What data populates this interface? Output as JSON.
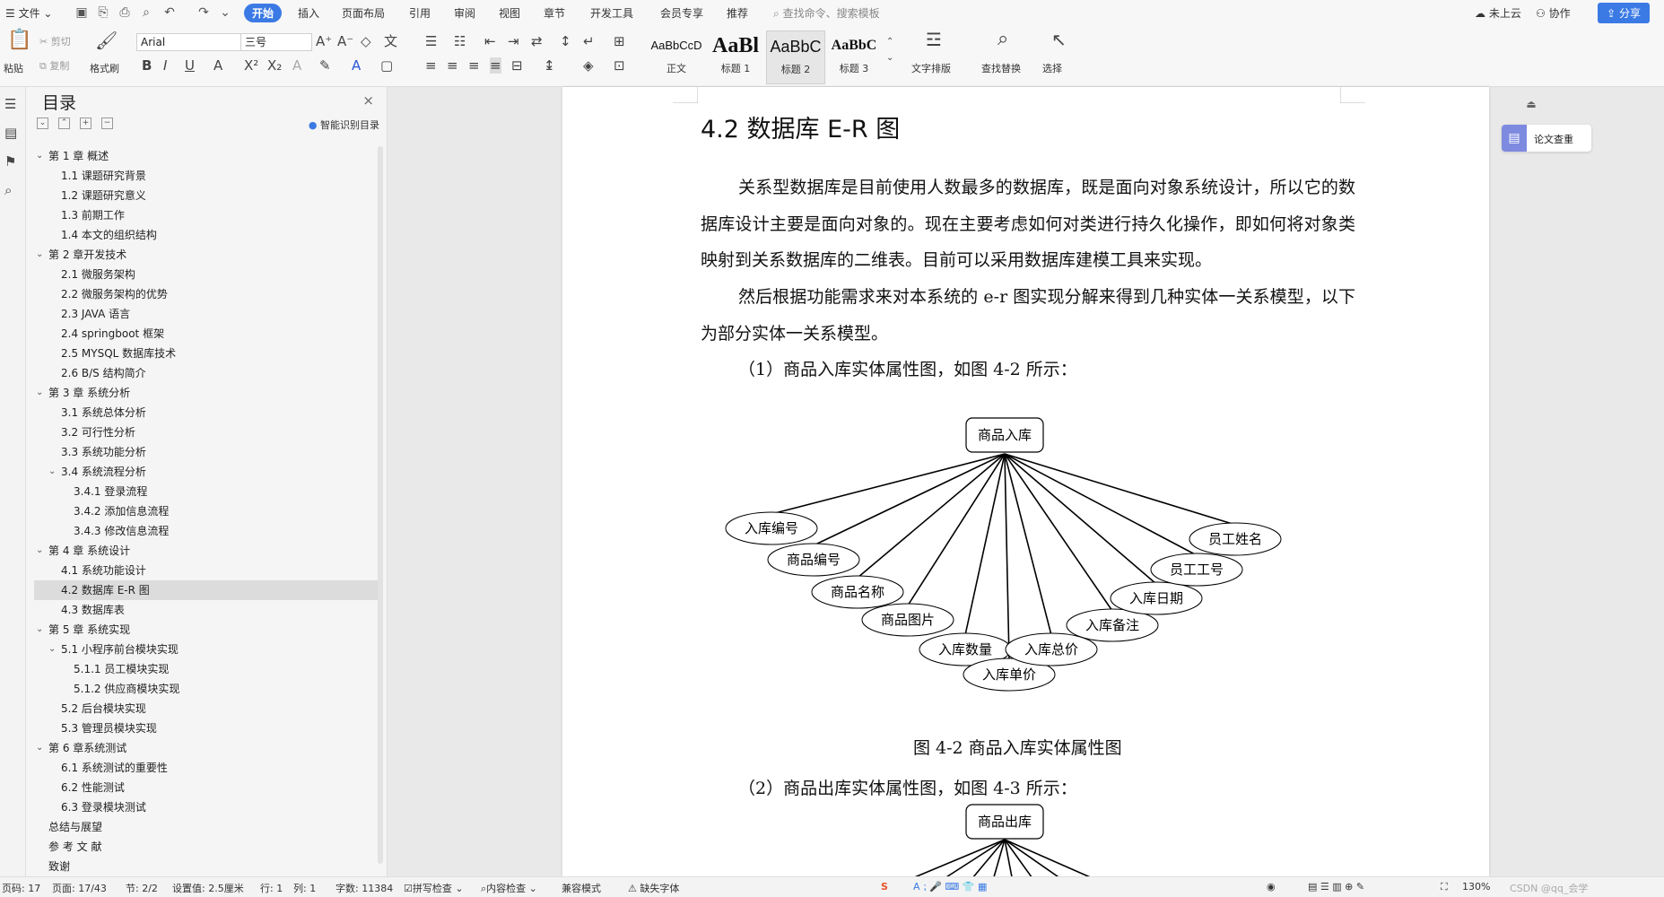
{
  "menubar": {
    "file_menu": "文件",
    "tabs": [
      "开始",
      "插入",
      "页面布局",
      "引用",
      "审阅",
      "视图",
      "章节",
      "开发工具",
      "会员专享",
      "推荐"
    ],
    "active_tab": "开始",
    "search_placeholder": "查找命令、搜索模板",
    "cloud_status": "未上云",
    "collab": "协作",
    "share": "分享"
  },
  "ribbon": {
    "paste": "粘贴",
    "cut": "剪切",
    "copy": "复制",
    "format_painter": "格式刷",
    "font_name": "Arial",
    "font_size": "三号",
    "styles": [
      {
        "preview": "AaBbCcD",
        "label": "正文"
      },
      {
        "preview": "AaBl",
        "label": "标题 1"
      },
      {
        "preview": "AaBbC",
        "label": "标题 2"
      },
      {
        "preview": "AaBbC",
        "label": "标题 3"
      }
    ],
    "text_layout": "文字排版",
    "find_replace": "查找替换",
    "select": "选择"
  },
  "toc": {
    "title": "目录",
    "smart_label": "智能识别目录",
    "items": [
      {
        "label": "第 1 章  概述",
        "level": 1,
        "expand": true,
        "selected": false
      },
      {
        "label": "1.1 课题研究背景",
        "level": 2,
        "expand": false,
        "selected": false
      },
      {
        "label": "1.2 课题研究意义",
        "level": 2,
        "expand": false,
        "selected": false
      },
      {
        "label": "1.3 前期工作",
        "level": 2,
        "expand": false,
        "selected": false
      },
      {
        "label": "1.4 本文的组织结构",
        "level": 2,
        "expand": false,
        "selected": false
      },
      {
        "label": "第 2 章开发技术",
        "level": 1,
        "expand": true,
        "selected": false
      },
      {
        "label": "2.1 微服务架构",
        "level": 2,
        "expand": false,
        "selected": false
      },
      {
        "label": "2.2 微服务架构的优势",
        "level": 2,
        "expand": false,
        "selected": false
      },
      {
        "label": "2.3 JAVA 语言",
        "level": 2,
        "expand": false,
        "selected": false
      },
      {
        "label": "2.4 springboot 框架",
        "level": 2,
        "expand": false,
        "selected": false
      },
      {
        "label": "2.5 MYSQL 数据库技术",
        "level": 2,
        "expand": false,
        "selected": false
      },
      {
        "label": "2.6 B/S 结构简介",
        "level": 2,
        "expand": false,
        "selected": false
      },
      {
        "label": "第 3 章  系统分析",
        "level": 1,
        "expand": true,
        "selected": false
      },
      {
        "label": "3.1 系统总体分析",
        "level": 2,
        "expand": false,
        "selected": false
      },
      {
        "label": "3.2 可行性分析",
        "level": 2,
        "expand": false,
        "selected": false
      },
      {
        "label": "3.3 系统功能分析",
        "level": 2,
        "expand": false,
        "selected": false
      },
      {
        "label": "3.4 系统流程分析",
        "level": 2,
        "expand": true,
        "selected": false
      },
      {
        "label": "3.4.1 登录流程",
        "level": 3,
        "expand": false,
        "selected": false
      },
      {
        "label": "3.4.2 添加信息流程",
        "level": 3,
        "expand": false,
        "selected": false
      },
      {
        "label": "3.4.3 修改信息流程",
        "level": 3,
        "expand": false,
        "selected": false
      },
      {
        "label": "第 4 章  系统设计",
        "level": 1,
        "expand": true,
        "selected": false
      },
      {
        "label": "4.1 系统功能设计",
        "level": 2,
        "expand": false,
        "selected": false
      },
      {
        "label": "4.2 数据库 E-R 图",
        "level": 2,
        "expand": false,
        "selected": true
      },
      {
        "label": "4.3 数据库表",
        "level": 2,
        "expand": false,
        "selected": false
      },
      {
        "label": "第 5 章  系统实现",
        "level": 1,
        "expand": true,
        "selected": false
      },
      {
        "label": "5.1 小程序前台模块实现",
        "level": 2,
        "expand": true,
        "selected": false
      },
      {
        "label": "5.1.1 员工模块实现",
        "level": 3,
        "expand": false,
        "selected": false
      },
      {
        "label": "5.1.2 供应商模块实现",
        "level": 3,
        "expand": false,
        "selected": false
      },
      {
        "label": "5.2 后台模块实现",
        "level": 2,
        "expand": false,
        "selected": false
      },
      {
        "label": "5.3 管理员模块实现",
        "level": 2,
        "expand": false,
        "selected": false
      },
      {
        "label": "第 6 章系统测试",
        "level": 1,
        "expand": true,
        "selected": false
      },
      {
        "label": "6.1 系统测试的重要性",
        "level": 2,
        "expand": false,
        "selected": false
      },
      {
        "label": "6.2 性能测试",
        "level": 2,
        "expand": false,
        "selected": false
      },
      {
        "label": "6.3 登录模块测试",
        "level": 2,
        "expand": false,
        "selected": false
      },
      {
        "label": "总结与展望",
        "level": 1,
        "expand": false,
        "selected": false
      },
      {
        "label": "参 考 文 献",
        "level": 1,
        "expand": false,
        "selected": false
      },
      {
        "label": "致谢",
        "level": 1,
        "expand": false,
        "selected": false
      }
    ]
  },
  "document": {
    "heading": "4.2 数据库 E-R 图",
    "para1": "关系型数据库是目前使用人数最多的数据库，既是面向对象系统设计，所以它的数据库设计主要是面向对象的。现在主要考虑如何对类进行持久化操作，即如何将对象类映射到关系数据库的二维表。目前可以采用数据库建模工具来实现。",
    "para2": "然后根据功能需求来对本系统的 e-r 图实现分解来得到几种实体一关系模型，以下为部分实体一关系模型。",
    "item1": "（1）商品入库实体属性图，如图 4-2 所示：",
    "figure1": {
      "entity": "商品入库",
      "attributes": [
        "入库编号",
        "商品编号",
        "商品名称",
        "商品图片",
        "入库数量",
        "入库单价",
        "入库总价",
        "入库备注",
        "入库日期",
        "员工工号",
        "员工姓名"
      ]
    },
    "caption1": "图 4-2 商品入库实体属性图",
    "item2": "（2）商品出库实体属性图，如图 4-3 所示：",
    "figure2": {
      "entity": "商品出库"
    }
  },
  "right_panel": {
    "paper_check": "论文查重"
  },
  "statusbar": {
    "page": "页码: 17",
    "page_of": "页面: 17/43",
    "section": "节: 2/2",
    "setting": "设置值: 2.5厘米",
    "row": "行: 1",
    "col": "列: 1",
    "words": "字数: 11384",
    "spell": "拼写检查",
    "content_check": "内容检查",
    "compat": "兼容模式",
    "missing_font": "缺失字体",
    "zoom": "130%",
    "watermark": "CSDN @qq_会学"
  },
  "colors": {
    "accent": "#3b7ae4",
    "panel": "#f5f5f5",
    "selected": "#dcdcdc"
  }
}
